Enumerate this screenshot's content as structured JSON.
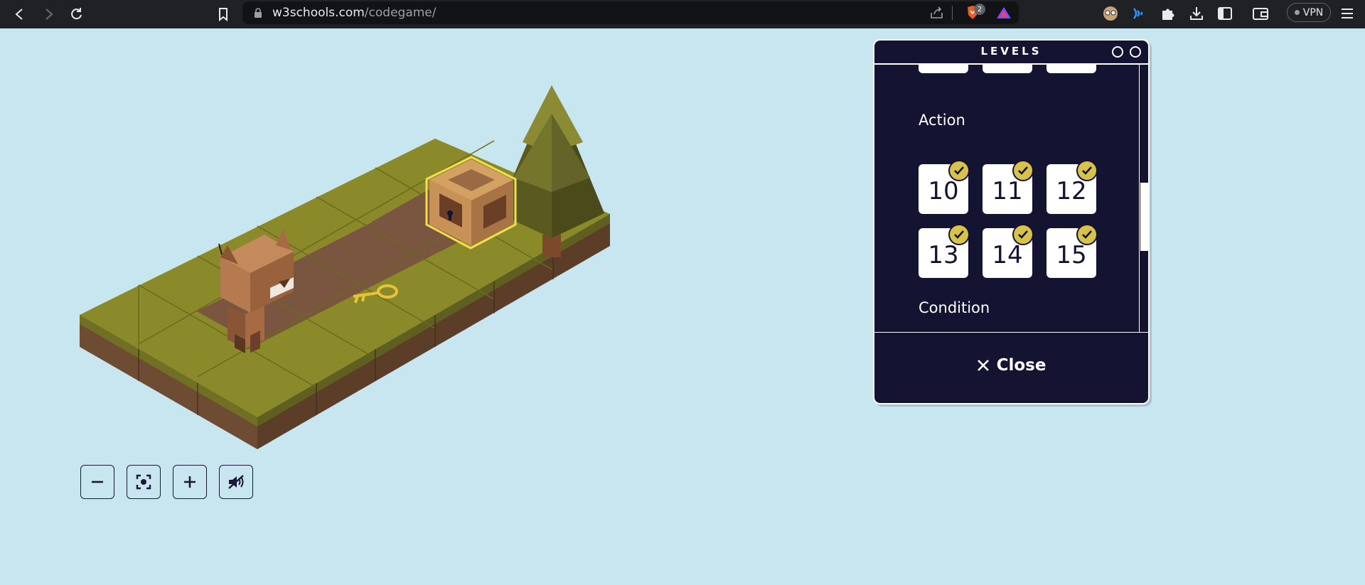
{
  "browser": {
    "url_domain": "w3schools.com",
    "url_path": "/codegame/",
    "tab_badge_count": "2",
    "vpn_label": "VPN"
  },
  "controls": {
    "zoom_out": "zoom-out",
    "recenter": "recenter",
    "zoom_in": "zoom-in",
    "sound": "sound-off"
  },
  "levels_panel": {
    "title": "LEVELS",
    "sections": [
      {
        "title": "Action",
        "levels": [
          {
            "number": "10",
            "completed": true
          },
          {
            "number": "11",
            "completed": true
          },
          {
            "number": "12",
            "completed": true
          },
          {
            "number": "13",
            "completed": true
          },
          {
            "number": "14",
            "completed": true
          },
          {
            "number": "15",
            "completed": true
          }
        ]
      },
      {
        "title": "Condition"
      }
    ],
    "close_label": "Close"
  },
  "colors": {
    "background": "#c8e6ef",
    "panel": "#141432",
    "check": "#d8c24a",
    "grass": "#8a8a2a",
    "dirt": "#7a5540"
  }
}
